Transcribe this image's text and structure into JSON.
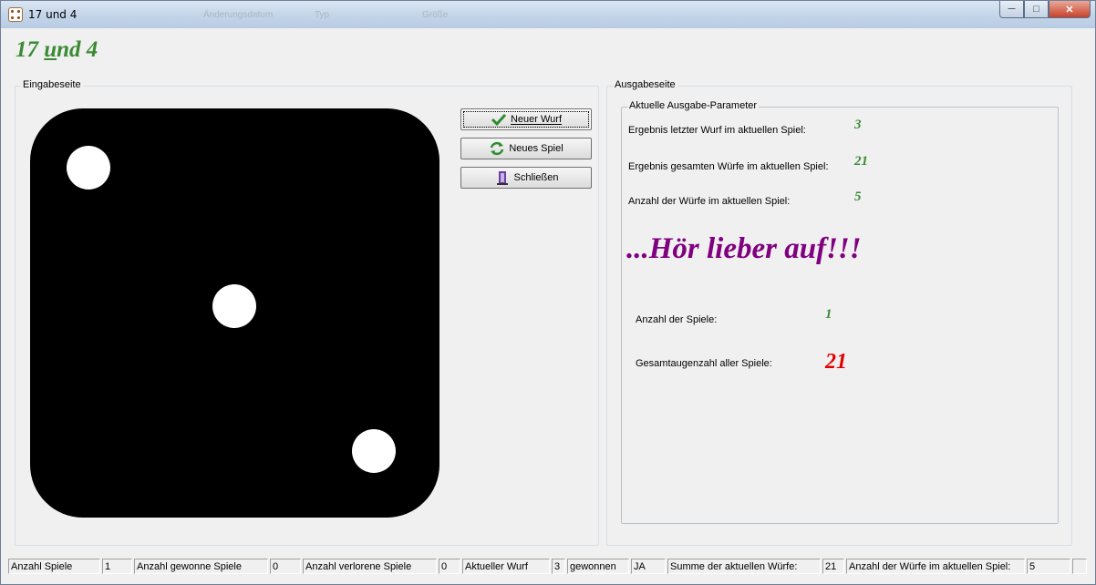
{
  "window": {
    "title": "17 und 4",
    "ghost_tabs": [
      "Änderungsdatum",
      "Typ",
      "Größe"
    ],
    "minimize_icon": "minimize-icon",
    "maximize_icon": "maximize-icon",
    "close_icon": "close-icon"
  },
  "heading": {
    "part1": "17 ",
    "part2_underlined": "u",
    "part3": "nd 4",
    "color": "#3a8a33"
  },
  "input_panel": {
    "legend": "Eingabeseite",
    "die_value": 3,
    "buttons": {
      "roll": "Neuer Wurf",
      "new_game": "Neues Spiel",
      "close": "Schließen"
    }
  },
  "output_panel": {
    "legend": "Ausgabeseite",
    "params_legend": "Aktuelle Ausgabe-Parameter",
    "last_roll_label": "Ergebnis letzter Wurf im aktuellen Spiel:",
    "last_roll_value": "3",
    "total_label": "Ergebnis gesamten Würfe im aktuellen Spiel:",
    "total_value": "21",
    "rolls_label": "Anzahl der Würfe im aktuellen Spiel:",
    "rolls_value": "5",
    "message": "...Hör lieber auf!!!",
    "message_color": "#800080",
    "games_label": "Anzahl der Spiele:",
    "games_value": "1",
    "overall_label": "Gesamtaugenzahl aller Spiele:",
    "overall_value": "21",
    "overall_color": "#e00000"
  },
  "statusbar": [
    "Anzahl Spiele",
    "1",
    "Anzahl gewonne Spiele",
    "0",
    "Anzahl verlorene Spiele",
    "0",
    "Aktueller Wurf",
    "3",
    "gewonnen",
    "JA",
    "Summe der aktuellen Würfe:",
    "21",
    "Anzahl der Würfe im aktuellen Spiel:",
    "5",
    ""
  ]
}
